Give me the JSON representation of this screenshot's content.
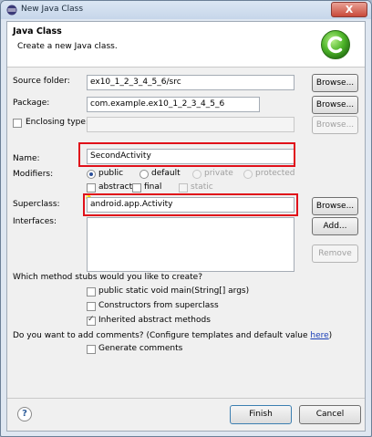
{
  "window": {
    "title": "New Java Class",
    "close_label": "X"
  },
  "header": {
    "title": "Java Class",
    "description": "Create a new Java class."
  },
  "source_folder": {
    "label": "Source folder:",
    "value": "ex10_1_2_3_4_5_6/src",
    "button": "Browse..."
  },
  "package": {
    "label": "Package:",
    "value": "com.example.ex10_1_2_3_4_5_6",
    "button": "Browse..."
  },
  "enclosing_type": {
    "label": "Enclosing type:",
    "value": "",
    "button": "Browse..."
  },
  "name": {
    "label": "Name:",
    "value": "SecondActivity"
  },
  "modifiers": {
    "label": "Modifiers:",
    "public": "public",
    "default": "default",
    "private": "private",
    "protected": "protected",
    "abstract": "abstract",
    "final": "final",
    "static": "static"
  },
  "superclass": {
    "label": "Superclass:",
    "value": "android.app.Activity",
    "button": "Browse..."
  },
  "interfaces": {
    "label": "Interfaces:",
    "add_button": "Add...",
    "remove_button": "Remove"
  },
  "stubs": {
    "question": "Which method stubs would you like to create?",
    "main": "public static void main(String[] args)",
    "constructors": "Constructors from superclass",
    "inherited": "Inherited abstract methods"
  },
  "comments": {
    "question": "Do you want to add comments? (Configure templates and default value ",
    "link": "here",
    "suffix": ")",
    "generate": "Generate comments"
  },
  "footer": {
    "help": "?",
    "finish": "Finish",
    "cancel": "Cancel"
  },
  "colors": {
    "highlight_box": "#e0101a",
    "link": "#1a3fb8"
  }
}
